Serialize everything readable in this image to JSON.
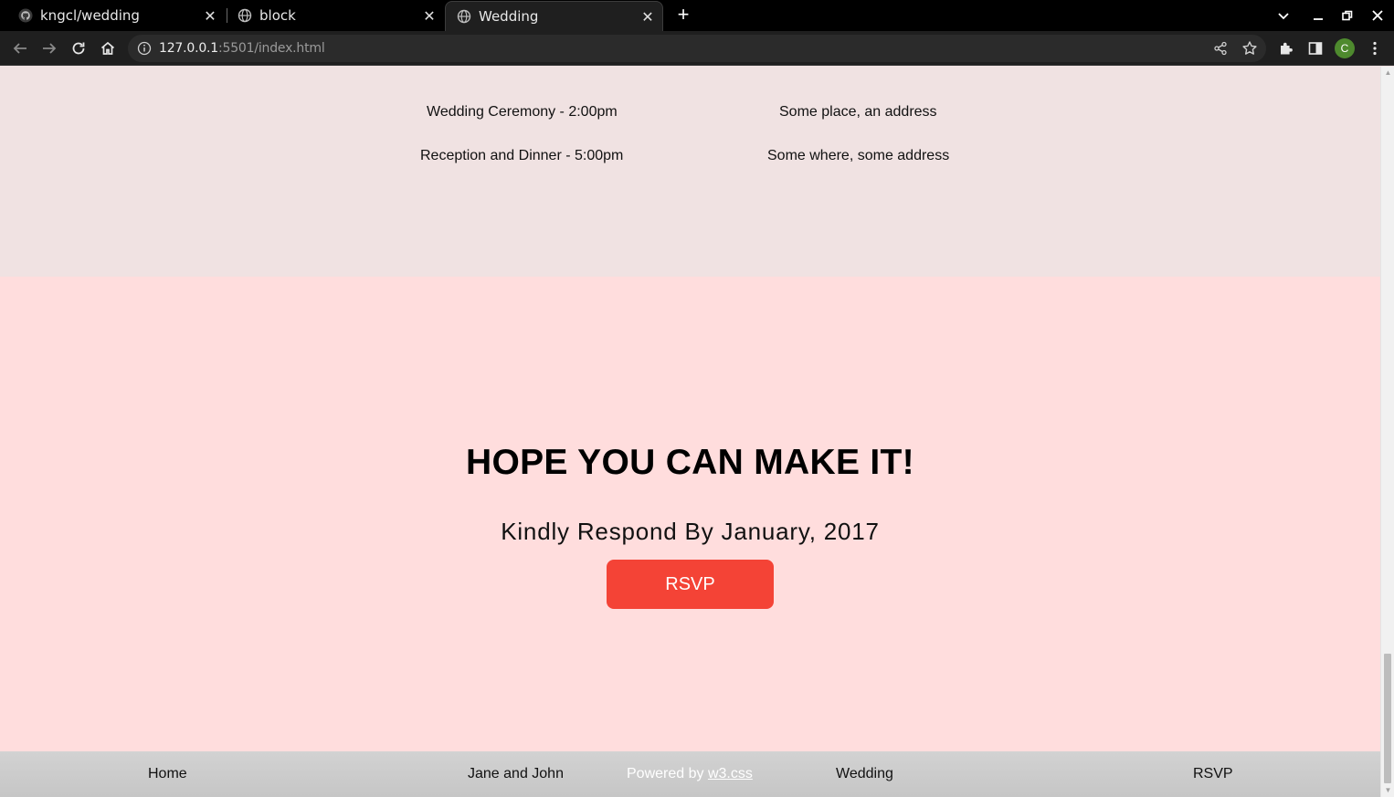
{
  "browser": {
    "tabs": [
      {
        "title": "kngcl/wedding",
        "icon": "github-icon"
      },
      {
        "title": "block",
        "icon": "globe-icon"
      },
      {
        "title": "Wedding",
        "icon": "globe-icon",
        "active": true
      }
    ],
    "url_host": "127.0.0.1",
    "url_rest": ":5501/index.html",
    "profile_initial": "C"
  },
  "schedule": {
    "events": [
      {
        "name": "Wedding Ceremony - 2:00pm",
        "place": "Some place, an address"
      },
      {
        "name": "Reception and Dinner - 5:00pm",
        "place": "Some where, some address"
      }
    ]
  },
  "rsvp": {
    "headline": "HOPE YOU CAN MAKE IT!",
    "respond_by": "Kindly Respond By January, 2017",
    "button_label": "RSVP"
  },
  "footer": {
    "home": "Home",
    "couple": "Jane and John",
    "powered_prefix": "Powered by ",
    "powered_link": "w3.css",
    "wedding": "Wedding",
    "rsvp": "RSVP"
  },
  "colors": {
    "schedule_bg": "#f0e2e2",
    "rsvp_bg": "#ffdddd",
    "button": "#f44336",
    "footer": "#cccccc"
  }
}
